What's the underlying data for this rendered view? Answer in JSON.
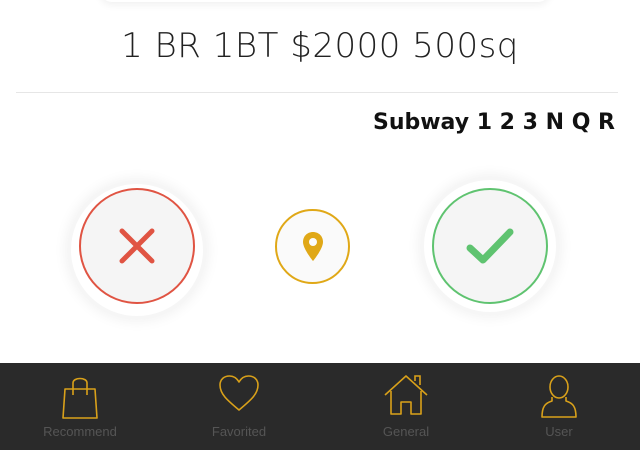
{
  "listing": {
    "title": "1 BR 1BT $2000 500sq",
    "transit": "Subway 1 2 3 N Q R"
  },
  "actions": {
    "reject_icon": "close-icon",
    "map_icon": "map-pin-icon",
    "accept_icon": "check-icon"
  },
  "colors": {
    "reject": "#e05443",
    "map": "#e0a817",
    "accept": "#5fc370",
    "tabbar_bg": "#2a2a2a",
    "tab_icon": "#d9a11a"
  },
  "tabbar": {
    "items": [
      {
        "label": "Recommend",
        "icon": "shopping-bag-icon"
      },
      {
        "label": "Favorited",
        "icon": "heart-icon"
      },
      {
        "label": "General",
        "icon": "home-icon"
      },
      {
        "label": "User",
        "icon": "user-icon"
      }
    ]
  }
}
